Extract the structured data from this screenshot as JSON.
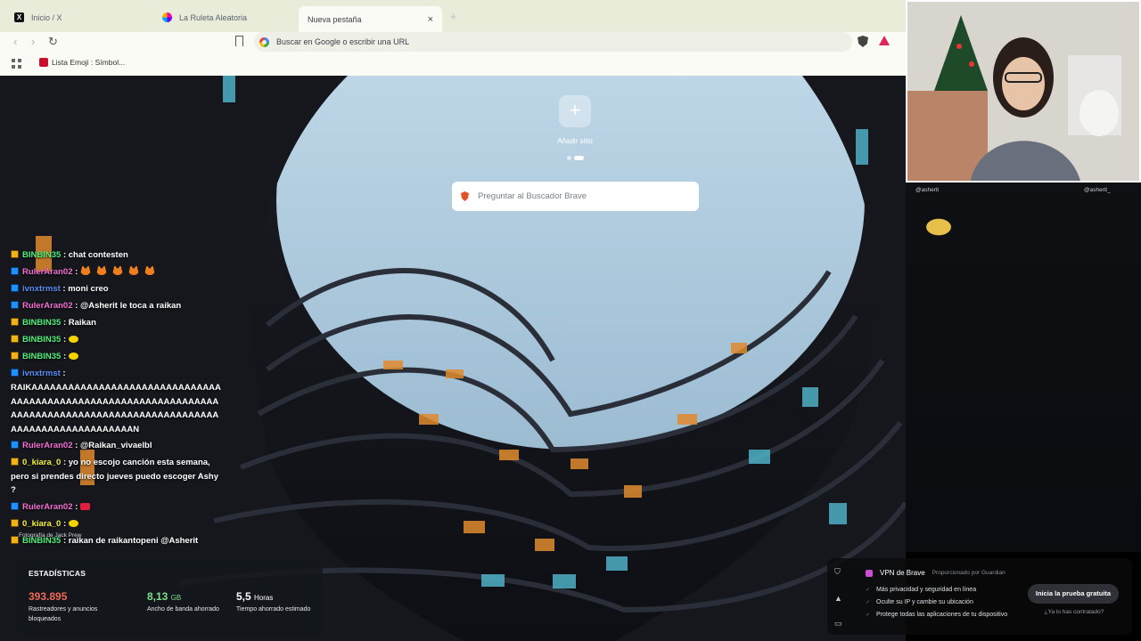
{
  "tabs": [
    {
      "label": "Inicio / X",
      "icon": "x-logo-icon"
    },
    {
      "label": "La Ruleta Aleatoria",
      "icon": "wheel-icon"
    },
    {
      "label": "Nueva pestaña",
      "icon": "none",
      "close": "×"
    }
  ],
  "new_tab_glyph": "+",
  "toolbar": {
    "back": "‹",
    "forward": "›",
    "reload": "↻",
    "url_placeholder": "Buscar en Google o escribir una URL"
  },
  "bookmarks": [
    {
      "label": "Lista Emoji : Símbol..."
    }
  ],
  "newtab_page": {
    "add_site_glyph": "+",
    "add_site_label": "Añadir sitio",
    "search_placeholder": "Preguntar al Buscador Brave",
    "photo_credit": "Fotografía de Jack Prew"
  },
  "stats": {
    "title": "ESTADÍSTICAS",
    "items": [
      {
        "value": "393.895",
        "unit": "",
        "label": "Rastreadores y anuncios bloqueados",
        "color": "#f06a5a"
      },
      {
        "value": "8,13",
        "unit": "GB",
        "label": "Ancho de banda ahorrado",
        "color": "#7fe08a"
      },
      {
        "value": "5,5",
        "unit": "Horas",
        "label": "Tiempo ahorrado estimado",
        "color": "#ffffff"
      }
    ]
  },
  "vpn": {
    "title": "VPN de Brave",
    "provider": "Proporcionado por  Guardian",
    "bullets": [
      "Más privacidad y seguridad en línea",
      "Oculte su IP y cambie su ubicación",
      "Protege todas las aplicaciones de tu dispositivo"
    ],
    "cta": "Inicia la prueba gratuita",
    "link": "¿Ya lo has contratado?"
  },
  "stream": {
    "social_left": "@asherit",
    "social_right": "@asherit_",
    "chat": [
      {
        "badge": "gold",
        "user": "BINBIN35",
        "color": "green",
        "text": ": chat contesten"
      },
      {
        "badge": "blue",
        "user": "RulerAran02",
        "color": "pink",
        "text": ":",
        "emotes": "fox5"
      },
      {
        "badge": "blue",
        "user": "ivnxtrmst",
        "color": "blue",
        "text": ": moni creo"
      },
      {
        "badge": "blue",
        "user": "RulerAran02",
        "color": "pink",
        "text": ": @Asherit le toca a raikan"
      },
      {
        "badge": "gold",
        "user": "BINBIN35",
        "color": "green",
        "text": ": Raikan"
      },
      {
        "badge": "gold",
        "user": "BINBIN35",
        "color": "green",
        "text": ":",
        "emotes": "yellow"
      },
      {
        "badge": "gold",
        "user": "BINBIN35",
        "color": "green",
        "text": ":",
        "emotes": "yellow"
      },
      {
        "badge": "blue",
        "user": "ivnxtrmst",
        "color": "blue",
        "text": ":"
      },
      {
        "badge": "none",
        "user": "",
        "color": "white",
        "text": "RAIKAAAAAAAAAAAAAAAAAAAAAAAAAAAAAAAAAAAAAAAAAAAAAAAAAAAAAAAAAAAAAAAAAAAAAAAAAAAAAAAAAAAAAAAAAAAAAAAAAAAAAAAAAAAAAAAAAAAAAAAN"
      },
      {
        "badge": "blue",
        "user": "RulerAran02",
        "color": "pink",
        "text": ": @Raikan_vivaelbl"
      },
      {
        "badge": "gold",
        "user": "0_kiara_0",
        "color": "yellow",
        "text": ": yo no escojo canción esta semana, pero si prendes directo jueves puedo escoger Ashy ?"
      },
      {
        "badge": "blue",
        "user": "RulerAran02",
        "color": "pink",
        "text": ":",
        "emotes": "red"
      },
      {
        "badge": "gold",
        "user": "0_kiara_0",
        "color": "yellow",
        "text": ":",
        "emotes": "yellow"
      },
      {
        "badge": "gold",
        "user": "BINBIN35",
        "color": "green",
        "text": ": raikan de raikantopeni @Asherit"
      }
    ]
  }
}
